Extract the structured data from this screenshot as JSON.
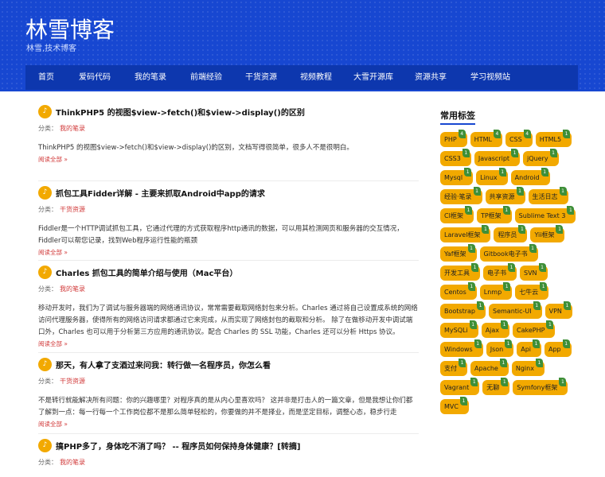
{
  "header": {
    "title": "林雪博客",
    "subtitle": "林雪,技术博客"
  },
  "nav": {
    "items": [
      "首页",
      "爱码代码",
      "我的笔录",
      "前端经验",
      "干货资源",
      "视频教程",
      "大雪开源库",
      "资源共享",
      "学习视频站"
    ]
  },
  "posts": [
    {
      "title": "ThinkPHP5 的视图$view->fetch()和$view->display()的区别",
      "meta_label": "分类：",
      "category": "我的笔录",
      "excerpt": "ThinkPHP5 的视图$view->fetch()和$view->display()的区别，文档写得很简单，很多人不是很明白。",
      "more": "阅读全部 »"
    },
    {
      "title": "抓包工具Fidder详解 - 主要来抓取Android中app的请求",
      "meta_label": "分类：",
      "category": "干货资源",
      "excerpt": "Fiddler是一个HTTP调试抓包工具，它通过代理的方式获取程序http通讯的数据，可以用其检测网页和服务器的交互情况，Fiddler可以帮您记录，找到Web程序运行性能的瓶颈",
      "more": "阅读全部 »"
    },
    {
      "title": "Charles 抓包工具的简单介绍与使用（Mac平台）",
      "meta_label": "分类：",
      "category": "我的笔录",
      "excerpt": "移动开发时，我们为了调试与服务器端的网络通讯协议，常常需要截取网络封包来分析。Charles 通过将自己设置成系统的网络访问代理服务器，使得所有的网络访问请求都通过它来完成，从而实现了网络封包的截取和分析。 除了在做移动开发中调试端口外，Charles 也可以用于分析第三方应用的通讯协议。配合 Charles 的 SSL 功能，Charles 还可以分析 Https 协议。",
      "more": "阅读全部 »"
    },
    {
      "title": "那天，有人拿了支酒过来问我：转行做一名程序员，你怎么看",
      "meta_label": "分类：",
      "category": "干货资源",
      "excerpt": "不是转行就能解决所有问题：你的兴趣哪里？对程序真的是从内心里喜欢吗？ 这并非是打击人的一篇文章，但是我想让你们都了解到一点：每一行每一个工作岗位都不是那么简单轻松的，你要做的并不是择业，而是坚定目标，调整心态，稳步行走",
      "more": "阅读全部 »"
    },
    {
      "title": "搞PHP多了，身体吃不消了吗？ -- 程序员如何保持身体健康？[转摘]",
      "meta_label": "分类：",
      "category": "我的笔录",
      "excerpt": "",
      "more": ""
    }
  ],
  "sidebar": {
    "title": "常用标签",
    "tags": [
      {
        "label": "PHP",
        "count": "4"
      },
      {
        "label": "HTML",
        "count": "4"
      },
      {
        "label": "CSS",
        "count": "4"
      },
      {
        "label": "HTML5",
        "count": "1"
      },
      {
        "label": "CSS3",
        "count": "1"
      },
      {
        "label": "Javascript",
        "count": "1"
      },
      {
        "label": "jQuery",
        "count": "1"
      },
      {
        "label": "Mysql",
        "count": "1"
      },
      {
        "label": "Linux",
        "count": "1"
      },
      {
        "label": "Android",
        "count": "1"
      },
      {
        "label": "经验·笔录",
        "count": "1"
      },
      {
        "label": "共享资源",
        "count": "1"
      },
      {
        "label": "生活日志",
        "count": "1"
      },
      {
        "label": "CI框架",
        "count": "1"
      },
      {
        "label": "TP框架",
        "count": "1"
      },
      {
        "label": "Sublime Text 3",
        "count": "1"
      },
      {
        "label": "Laravel框架",
        "count": "1"
      },
      {
        "label": "程序员",
        "count": "1"
      },
      {
        "label": "Yii框架",
        "count": "1"
      },
      {
        "label": "Yaf框架",
        "count": "1"
      },
      {
        "label": "Gitbook电子书",
        "count": "1"
      },
      {
        "label": "开发工具",
        "count": "1"
      },
      {
        "label": "电子书",
        "count": "1"
      },
      {
        "label": "SVN",
        "count": "1"
      },
      {
        "label": "Centos",
        "count": "1"
      },
      {
        "label": "Lnmp",
        "count": "1"
      },
      {
        "label": "七牛云",
        "count": "1"
      },
      {
        "label": "Bootstrap",
        "count": "1"
      },
      {
        "label": "Semantic-UI",
        "count": "1"
      },
      {
        "label": "VPN",
        "count": "1"
      },
      {
        "label": "MySQLi",
        "count": "1"
      },
      {
        "label": "Ajax",
        "count": "1"
      },
      {
        "label": "CakePHP",
        "count": "1"
      },
      {
        "label": "Windows",
        "count": "1"
      },
      {
        "label": "Json",
        "count": "1"
      },
      {
        "label": "Api",
        "count": "1"
      },
      {
        "label": "App",
        "count": "1"
      },
      {
        "label": "支付",
        "count": "1"
      },
      {
        "label": "Apache",
        "count": "1"
      },
      {
        "label": "Nginx",
        "count": "1"
      },
      {
        "label": "Vagrant",
        "count": "1"
      },
      {
        "label": "无聊",
        "count": "1"
      },
      {
        "label": "Symfony框架",
        "count": "1"
      },
      {
        "label": "MVC",
        "count": "1"
      }
    ]
  }
}
